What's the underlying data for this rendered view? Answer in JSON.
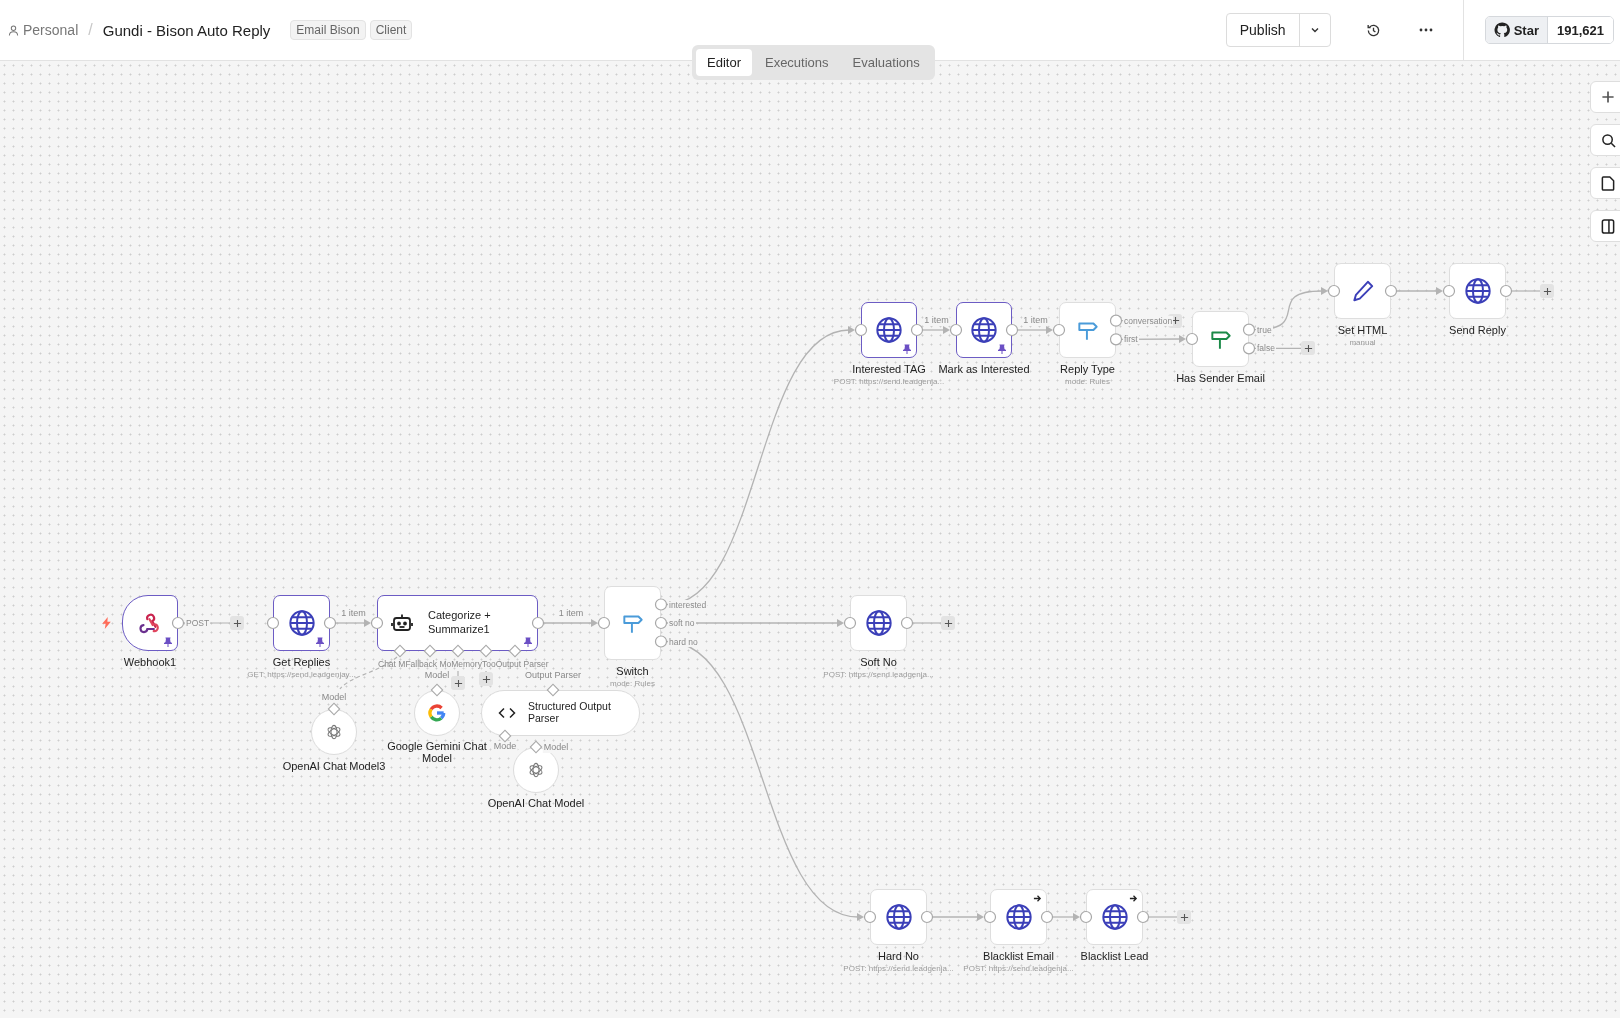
{
  "header": {
    "owner": "Personal",
    "separator": "/",
    "workflow_title": "Gundi - Bison Auto Reply",
    "tags": [
      "Email Bison",
      "Client"
    ],
    "publish_button": "Publish",
    "github": {
      "label": "Star",
      "count": "191,621"
    }
  },
  "view_tabs": [
    {
      "label": "Editor",
      "selected": true
    },
    {
      "label": "Executions",
      "selected": false
    },
    {
      "label": "Evaluations",
      "selected": false
    }
  ],
  "nodes": [
    {
      "kind": "webhook",
      "name": "Webhook1",
      "pinned": true,
      "arrow_badge": false,
      "outputs": [
        "POST"
      ]
    },
    {
      "kind": "http",
      "name": "Get Replies",
      "subtitle": "GET: https://send.leadgenjay...",
      "pinned": true,
      "arrow_badge": false,
      "edge_label": "1 item"
    },
    {
      "kind": "agent",
      "name": "Categorize + Summarize1",
      "pinned": true,
      "arrow_badge": false,
      "edge_label": "1 item",
      "inputs": [
        "Chat M",
        "Fallback Mo",
        "Memory",
        "Too",
        "Output Parser"
      ]
    },
    {
      "kind": "switch",
      "name": "Switch",
      "subtitle": "mode: Rules",
      "pinned": false,
      "arrow_badge": false,
      "outputs": [
        "interested",
        "soft no",
        "hard no"
      ]
    },
    {
      "kind": "http",
      "name": "Interested TAG",
      "subtitle": "POST: https://send.leadgenja...",
      "pinned": true,
      "arrow_badge": false,
      "edge_label": "1 item"
    },
    {
      "kind": "http",
      "name": "Mark as Interested",
      "pinned": true,
      "arrow_badge": false,
      "edge_label": "1 item"
    },
    {
      "kind": "switch",
      "name": "Reply Type",
      "subtitle": "mode: Rules",
      "pinned": false,
      "arrow_badge": false,
      "outputs": [
        "conversation",
        "first"
      ]
    },
    {
      "kind": "if",
      "name": "Has Sender Email",
      "pinned": false,
      "arrow_badge": false,
      "outputs": [
        "true",
        "false"
      ]
    },
    {
      "kind": "set",
      "name": "Set HTML",
      "subtitle": "manual",
      "pinned": false,
      "arrow_badge": false
    },
    {
      "kind": "http",
      "name": "Send Reply",
      "pinned": false,
      "arrow_badge": false
    },
    {
      "kind": "http",
      "name": "Soft No",
      "subtitle": "POST: https://send.leadgenja...",
      "pinned": false,
      "arrow_badge": false
    },
    {
      "kind": "http",
      "name": "Hard No",
      "subtitle": "POST: https://send.leadgenja...",
      "pinned": false,
      "arrow_badge": false
    },
    {
      "kind": "http",
      "name": "Blacklist Email",
      "subtitle": "POST: https://send.leadgenja...",
      "pinned": false,
      "arrow_badge": true
    },
    {
      "kind": "http",
      "name": "Blacklist Lead",
      "pinned": false,
      "arrow_badge": true
    }
  ],
  "sub_nodes": [
    {
      "kind": "openai",
      "name": "OpenAI Chat Model3",
      "input_label": "Model"
    },
    {
      "kind": "gemini",
      "name": "Google Gemini Chat Model",
      "input_label": "Model"
    },
    {
      "kind": "parser",
      "name": "Structured Output Parser",
      "input_label": "Output Parser",
      "model_label": "Mode"
    },
    {
      "kind": "openai",
      "name": "OpenAI Chat Model",
      "input_label": "Model"
    }
  ]
}
